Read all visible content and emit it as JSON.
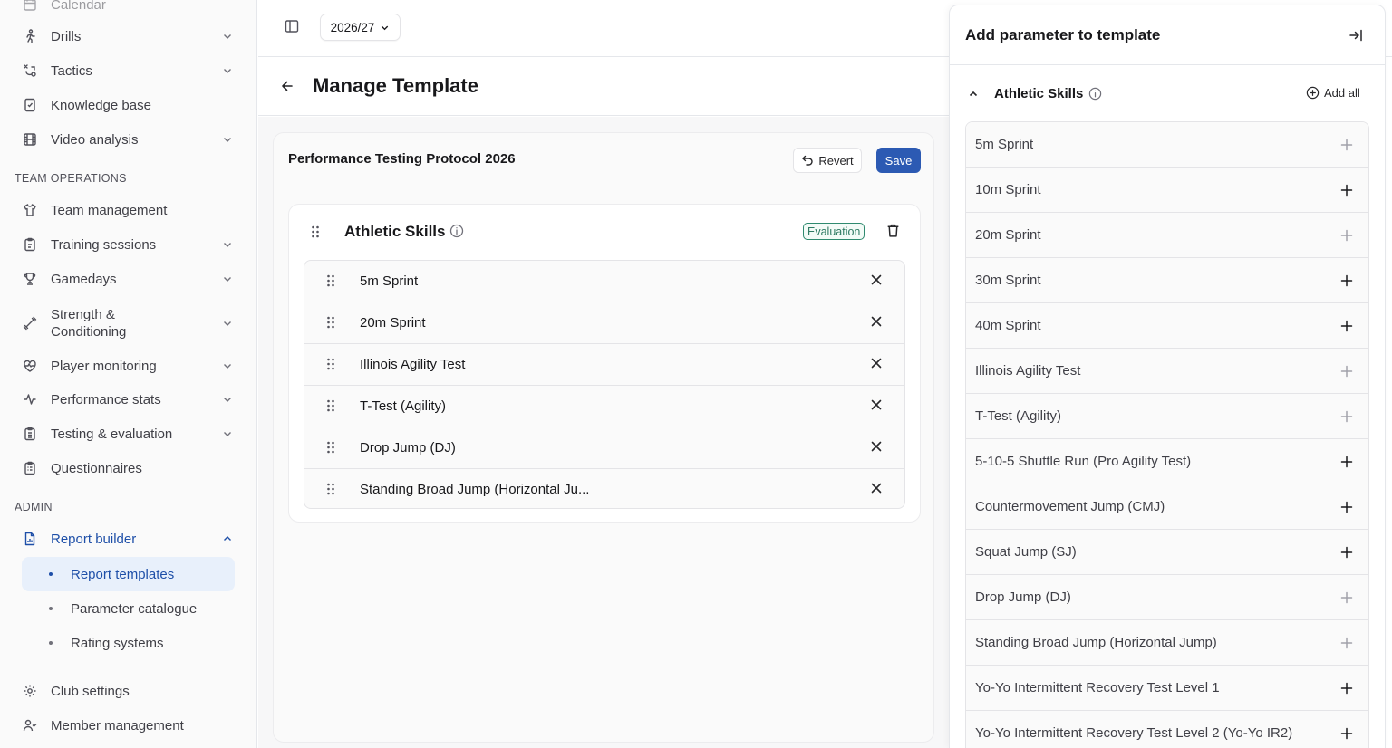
{
  "sidebar": {
    "items": [
      {
        "label": "Calendar",
        "icon": "calendar-icon"
      },
      {
        "label": "Drills",
        "icon": "running-person-icon"
      },
      {
        "label": "Tactics",
        "icon": "tactics-icon"
      },
      {
        "label": "Knowledge base",
        "icon": "book-icon"
      },
      {
        "label": "Video analysis",
        "icon": "film-icon"
      }
    ],
    "team_operations_label": "TEAM OPERATIONS",
    "team_items": [
      {
        "label": "Team management",
        "icon": "shirt-icon"
      },
      {
        "label": "Training sessions",
        "icon": "clipboard-icon"
      },
      {
        "label": "Gamedays",
        "icon": "trophy-icon"
      },
      {
        "label": "Strength & Conditioning",
        "icon": "dumbbell-icon"
      },
      {
        "label": "Player monitoring",
        "icon": "heart-pulse-icon"
      },
      {
        "label": "Performance stats",
        "icon": "activity-icon"
      },
      {
        "label": "Testing & evaluation",
        "icon": "clipboard-list-icon"
      },
      {
        "label": "Questionnaires",
        "icon": "questionnaire-icon"
      }
    ],
    "admin_label": "ADMIN",
    "admin_items": [
      {
        "label": "Report builder",
        "icon": "report-icon"
      }
    ],
    "report_sub": [
      {
        "label": "Report templates"
      },
      {
        "label": "Parameter catalogue"
      },
      {
        "label": "Rating systems"
      }
    ],
    "bottom_items": [
      {
        "label": "Club settings",
        "icon": "gear-icon"
      },
      {
        "label": "Member management",
        "icon": "users-icon"
      }
    ]
  },
  "topbar": {
    "season": "2026/27"
  },
  "page": {
    "title": "Manage Template"
  },
  "template": {
    "name": "Performance Testing Protocol 2026",
    "revert_label": "Revert",
    "save_label": "Save",
    "group": {
      "title": "Athletic Skills",
      "badge": "Evaluation",
      "parameters": [
        "5m Sprint",
        "20m Sprint",
        "Illinois Agility Test",
        "T-Test (Agility)",
        "Drop Jump (DJ)",
        "Standing Broad Jump (Horizontal Ju..."
      ]
    }
  },
  "panel": {
    "title": "Add parameter to template",
    "section_title": "Athletic Skills",
    "add_all_label": "Add all",
    "parameters": [
      {
        "name": "5m Sprint",
        "added": true
      },
      {
        "name": "10m Sprint",
        "added": false
      },
      {
        "name": "20m Sprint",
        "added": true
      },
      {
        "name": "30m Sprint",
        "added": false
      },
      {
        "name": "40m Sprint",
        "added": false
      },
      {
        "name": "Illinois Agility Test",
        "added": true
      },
      {
        "name": "T-Test (Agility)",
        "added": true
      },
      {
        "name": "5-10-5 Shuttle Run (Pro Agility Test)",
        "added": false
      },
      {
        "name": "Countermovement Jump (CMJ)",
        "added": false
      },
      {
        "name": "Squat Jump (SJ)",
        "added": false
      },
      {
        "name": "Drop Jump (DJ)",
        "added": true
      },
      {
        "name": "Standing Broad Jump (Horizontal Jump)",
        "added": true
      },
      {
        "name": "Yo-Yo Intermittent Recovery Test Level 1",
        "added": false
      },
      {
        "name": "Yo-Yo Intermittent Recovery Test Level 2 (Yo-Yo IR2)",
        "added": false
      }
    ]
  },
  "colors": {
    "accent": "#2c5ab3",
    "active_text": "#1e4fa8",
    "active_bg": "#e8f0fb",
    "badge": "#2f8a6f"
  }
}
